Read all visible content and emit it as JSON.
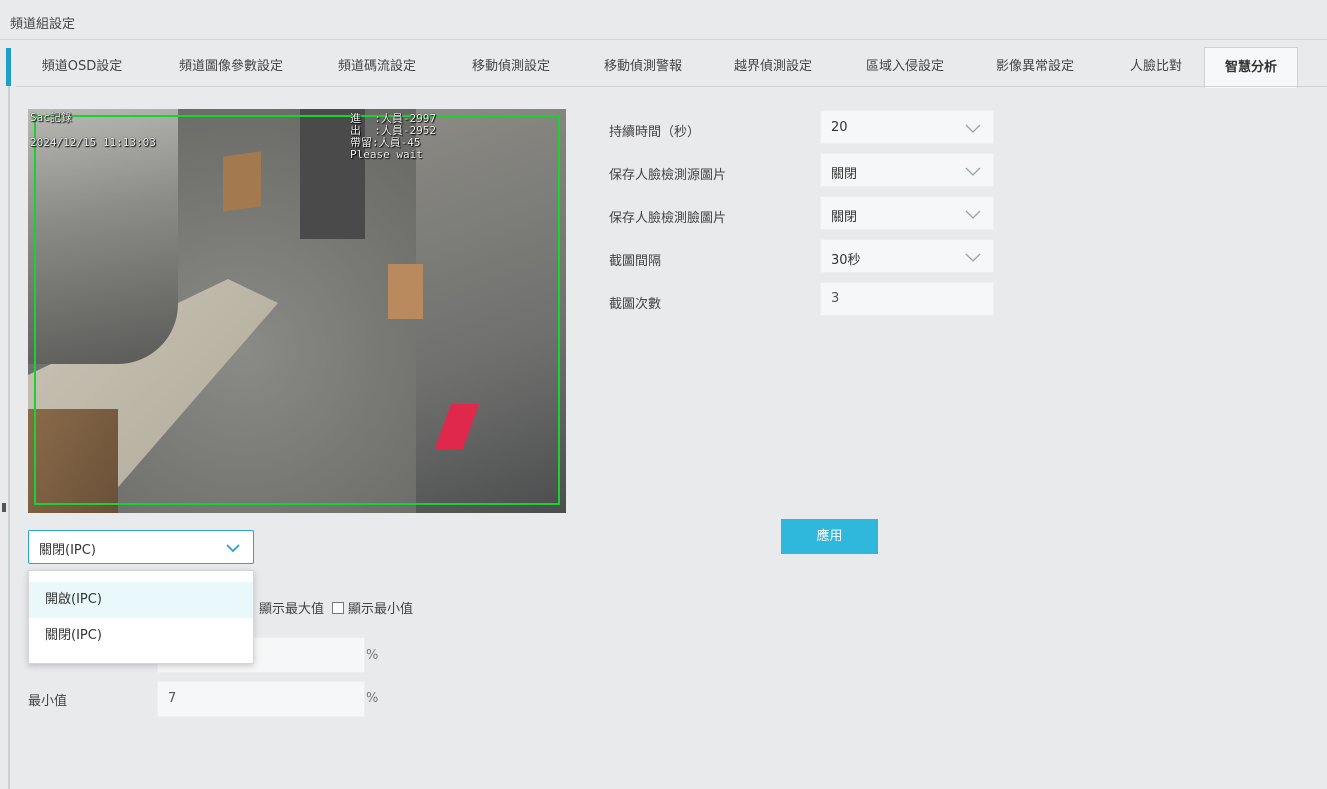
{
  "header": {
    "title": "頻道組設定"
  },
  "tabs": [
    {
      "label": "頻道OSD設定"
    },
    {
      "label": "頻道圖像參數設定"
    },
    {
      "label": "頻道碼流設定"
    },
    {
      "label": "移動偵測設定"
    },
    {
      "label": "移動偵測警報"
    },
    {
      "label": "越界偵測設定"
    },
    {
      "label": "區域入侵設定"
    },
    {
      "label": "影像異常設定"
    },
    {
      "label": "人臉比對"
    },
    {
      "label": "智慧分析"
    }
  ],
  "active_tab": "智慧分析",
  "preview": {
    "osd_camera_name": "Sac記錄",
    "osd_datetime": "2024/12/15 11:13:03",
    "osd_counters": "進  :人員-2997\n出  :人員-2952\n帶留:人員-45\nPlease wait",
    "roi_color": "#1bd12f",
    "marker_color": "#e0284a"
  },
  "display_mode": {
    "selected": "關閉(IPC)",
    "options": [
      "開啟(IPC)",
      "關閉(IPC)"
    ],
    "highlighted": "開啟(IPC)"
  },
  "checkboxes": {
    "show_max": "顯示最大值",
    "show_min": "顯示最小值"
  },
  "thresholds": {
    "min_label": "最小值",
    "min_value": "7",
    "max_value": "",
    "unit": "%"
  },
  "settings": {
    "duration": {
      "label": "持續時間（秒）",
      "value": "20"
    },
    "save_source": {
      "label": "保存人臉檢測源圖片",
      "value": "關閉"
    },
    "save_face": {
      "label": "保存人臉檢測臉圖片",
      "value": "關閉"
    },
    "snap_interval": {
      "label": "截圖間隔",
      "value": "30秒"
    },
    "snap_count": {
      "label": "截圖次數",
      "value": "3"
    }
  },
  "apply_label": "應用",
  "colors": {
    "accent": "#1e9fc9",
    "button": "#2fb8dc"
  }
}
